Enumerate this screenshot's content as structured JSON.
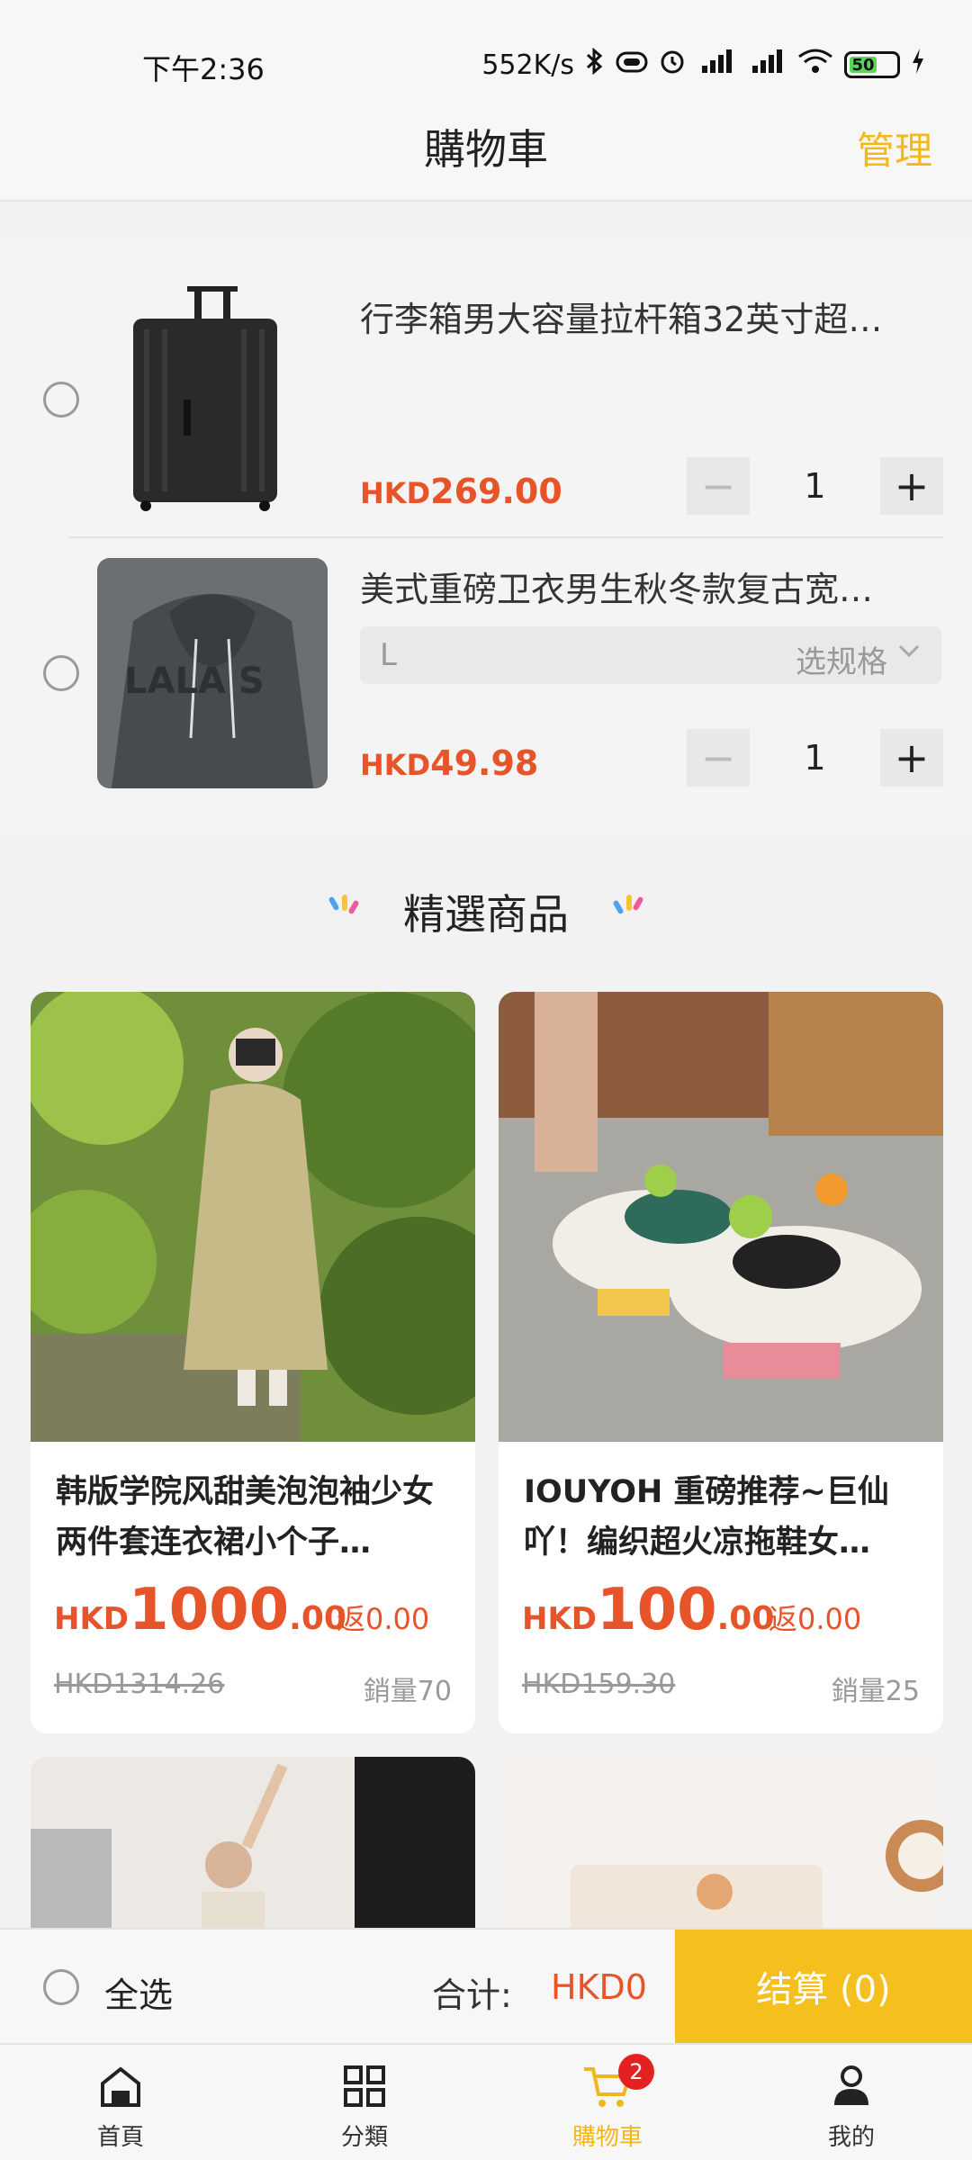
{
  "status_bar": {
    "time": "下午2:36",
    "network_speed": "552K/s",
    "battery_level": "50"
  },
  "header": {
    "title": "購物車",
    "manage_label": "管理"
  },
  "cart": {
    "items": [
      {
        "title": "行李箱男大容量拉杆箱32英寸超…",
        "currency": "HKD",
        "price": "269.00",
        "quantity": "1"
      },
      {
        "title": "美式重磅卫衣男生秋冬款复古宽…",
        "spec_value": "L",
        "spec_label": "选规格",
        "currency": "HKD",
        "price": "49.98",
        "quantity": "1"
      }
    ]
  },
  "featured": {
    "title": "精選商品",
    "products": [
      {
        "name": "韩版学院风甜美泡泡袖少女两件套连衣裙小个子…",
        "currency": "HKD",
        "price_int": "1000",
        "price_dec": ".00",
        "rebate": "返0.00",
        "old_price": "HKD1314.26",
        "sales": "銷量70"
      },
      {
        "name": "IOUYOH 重磅推荐~巨仙吖！编织超火凉拖鞋女…",
        "currency": "HKD",
        "price_int": "100",
        "price_dec": ".00",
        "rebate": "返0.00",
        "old_price": "HKD159.30",
        "sales": "銷量25"
      }
    ]
  },
  "checkout": {
    "select_all_label": "全选",
    "total_label": "合计:",
    "total_value": "HKD0",
    "checkout_label": "结算 (0)"
  },
  "tabbar": {
    "tabs": [
      {
        "label": "首頁",
        "icon": "home-icon"
      },
      {
        "label": "分類",
        "icon": "grid-icon"
      },
      {
        "label": "購物車",
        "icon": "cart-icon",
        "badge": "2",
        "active": true
      },
      {
        "label": "我的",
        "icon": "user-icon"
      }
    ]
  },
  "colors": {
    "accent": "#f5bf1e",
    "price": "#e8542a",
    "badge": "#e42121"
  }
}
